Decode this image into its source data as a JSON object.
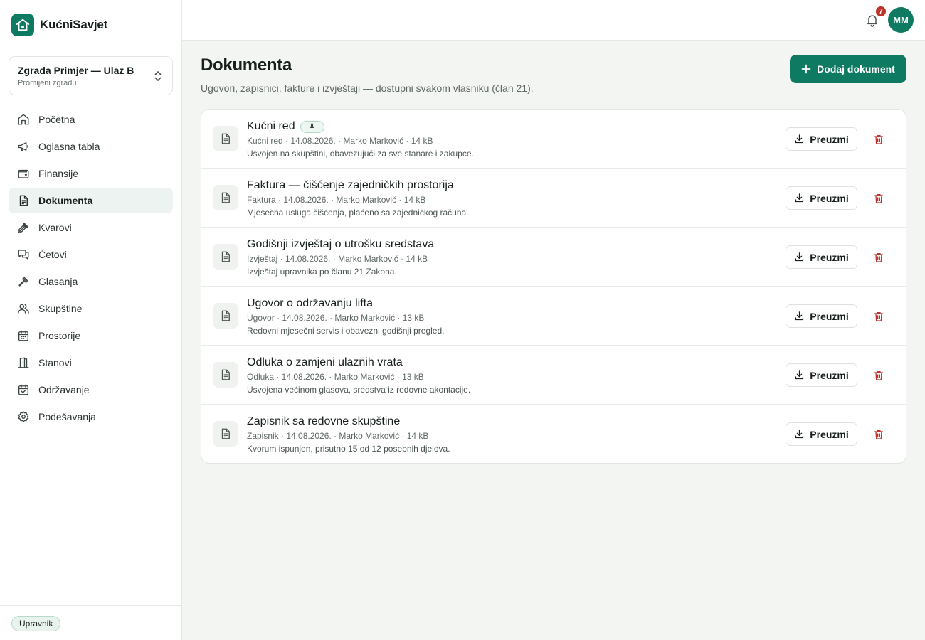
{
  "app": {
    "name": "KućniSavjet"
  },
  "building": {
    "name": "Zgrada Primjer — Ulaz B",
    "change_label": "Promijeni zgradu"
  },
  "nav": [
    {
      "label": "Početna",
      "icon": "home-icon",
      "active": false
    },
    {
      "label": "Oglasna tabla",
      "icon": "megaphone-icon",
      "active": false
    },
    {
      "label": "Finansije",
      "icon": "wallet-icon",
      "active": false
    },
    {
      "label": "Dokumenta",
      "icon": "document-icon",
      "active": true
    },
    {
      "label": "Kvarovi",
      "icon": "wrench-icon",
      "active": false
    },
    {
      "label": "Četovi",
      "icon": "chat-icon",
      "active": false
    },
    {
      "label": "Glasanja",
      "icon": "gavel-icon",
      "active": false
    },
    {
      "label": "Skupštine",
      "icon": "users-icon",
      "active": false
    },
    {
      "label": "Prostorije",
      "icon": "calendar-icon",
      "active": false
    },
    {
      "label": "Stanovi",
      "icon": "door-icon",
      "active": false
    },
    {
      "label": "Održavanje",
      "icon": "calendar-check-icon",
      "active": false
    },
    {
      "label": "Podešavanja",
      "icon": "gear-icon",
      "active": false
    }
  ],
  "role": "Upravnik",
  "topbar": {
    "notifications": "7",
    "avatar_initials": "MM"
  },
  "page": {
    "title": "Dokumenta",
    "subtitle": "Ugovori, zapisnici, fakture i izvještaji — dostupni svakom vlasniku (član 21).",
    "add_button": "Dodaj dokument"
  },
  "download_label": "Preuzmi",
  "documents": [
    {
      "title": "Kućni red",
      "pinned": true,
      "meta": "Kućni red · 14.08.2026. · Marko Marković · 14 kB",
      "desc": "Usvojen na skupštini, obavezujući za sve stanare i zakupce."
    },
    {
      "title": "Faktura — čišćenje zajedničkih prostorija",
      "pinned": false,
      "meta": "Faktura · 14.08.2026. · Marko Marković · 14 kB",
      "desc": "Mjesečna usluga čišćenja, plaćeno sa zajedničkog računa."
    },
    {
      "title": "Godišnji izvještaj o utrošku sredstava",
      "pinned": false,
      "meta": "Izvještaj · 14.08.2026. · Marko Marković · 14 kB",
      "desc": "Izvještaj upravnika po članu 21 Zakona."
    },
    {
      "title": "Ugovor o održavanju lifta",
      "pinned": false,
      "meta": "Ugovor · 14.08.2026. · Marko Marković · 13 kB",
      "desc": "Redovni mjesečni servis i obavezni godišnji pregled."
    },
    {
      "title": "Odluka o zamjeni ulaznih vrata",
      "pinned": false,
      "meta": "Odluka · 14.08.2026. · Marko Marković · 13 kB",
      "desc": "Usvojena većinom glasova, sredstva iz redovne akontacije."
    },
    {
      "title": "Zapisnik sa redovne skupštine",
      "pinned": false,
      "meta": "Zapisnik · 14.08.2026. · Marko Marković · 14 kB",
      "desc": "Kvorum ispunjen, prisutno 15 od 12 posebnih djelova."
    }
  ],
  "colors": {
    "brand": "#0f7a62",
    "danger": "#c0312b",
    "active_nav_bg": "#edf3f0"
  }
}
